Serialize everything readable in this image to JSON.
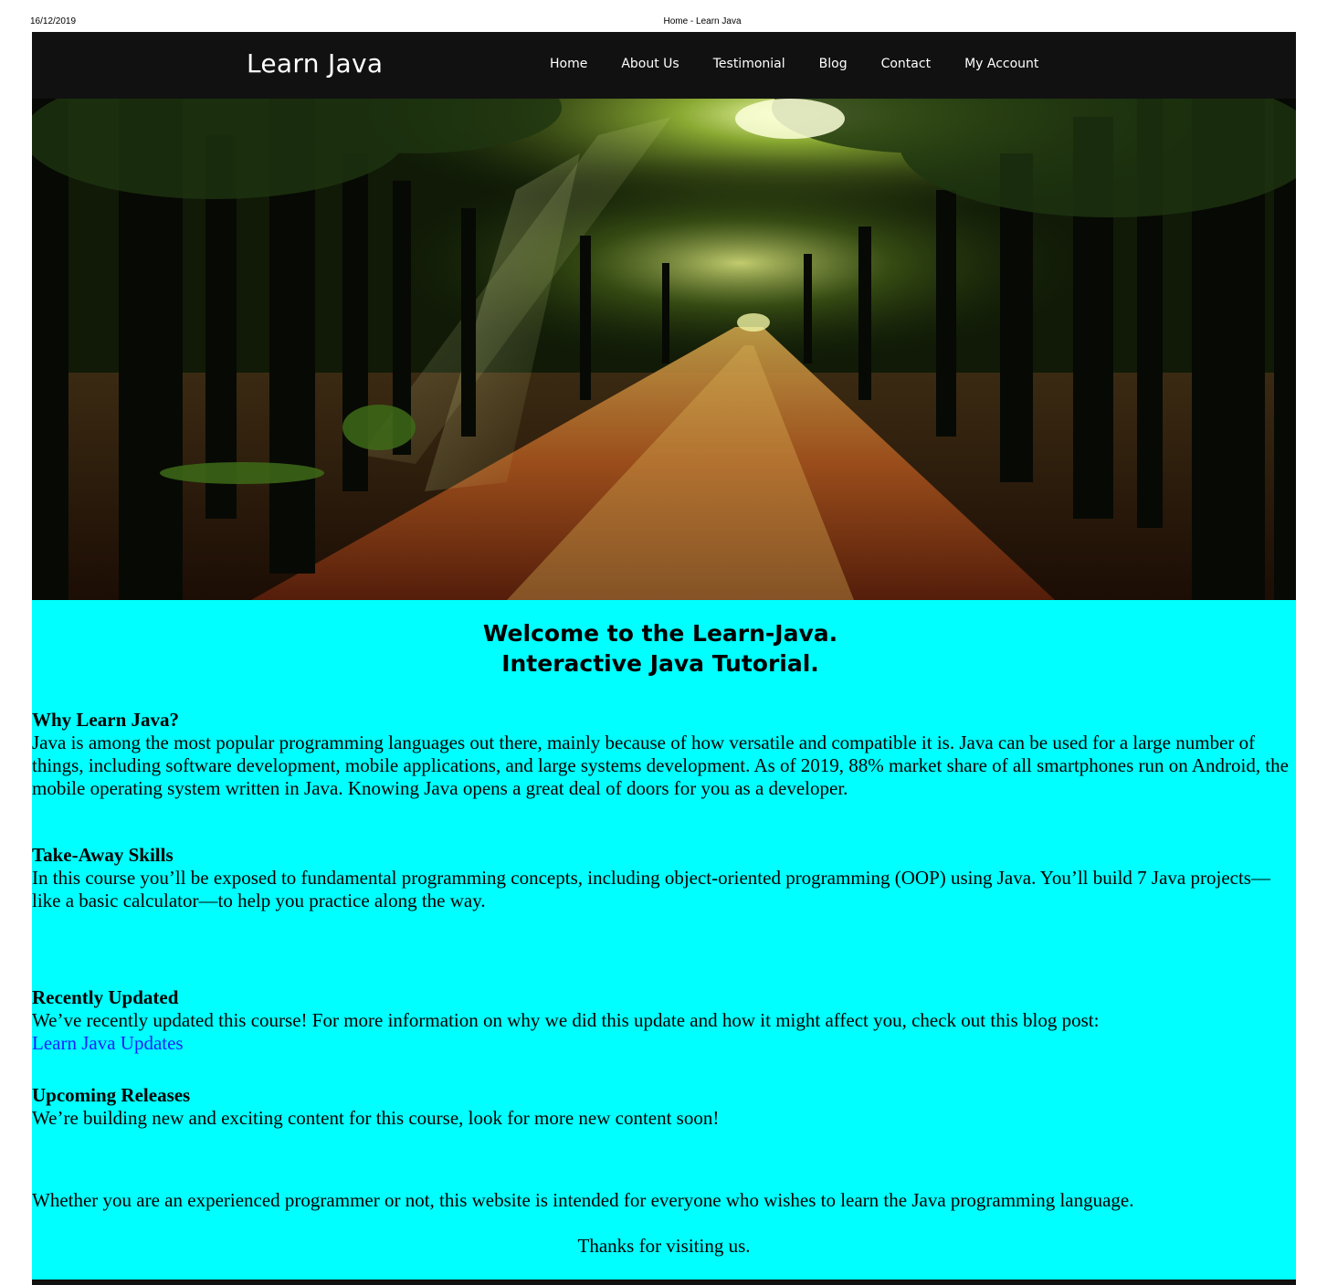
{
  "print": {
    "date": "16/12/2019",
    "title": "Home - Learn Java"
  },
  "navbar": {
    "brand": "Learn Java",
    "items": [
      {
        "label": "Home"
      },
      {
        "label": "About Us"
      },
      {
        "label": "Testimonial"
      },
      {
        "label": "Blog"
      },
      {
        "label": "Contact"
      },
      {
        "label": "My Account"
      }
    ]
  },
  "main": {
    "welcome_line1": "Welcome to the Learn-Java.",
    "welcome_line2": "Interactive Java Tutorial.",
    "why": {
      "heading": "Why Learn Java?",
      "body": "Java is among the most popular programming languages out there, mainly because of how versatile and compatible it is. Java can be used for a large number of things, including software development, mobile applications, and large systems development. As of 2019, 88% market share of all smartphones run on Android, the mobile operating system written in Java. Knowing Java opens a great deal of doors for you as a developer."
    },
    "skills": {
      "heading": "Take-Away Skills",
      "body": "In this course you’ll be exposed to fundamental programming concepts, including object-oriented programming (OOP) using Java. You’ll build 7 Java projects—like a basic calculator—to help you practice along the way."
    },
    "updated": {
      "heading": "Recently Updated",
      "body": "We’ve recently updated this course! For more information on why we did this update and how it might affect you, check out this blog post:",
      "link": "Learn Java Updates"
    },
    "upcoming": {
      "heading": "Upcoming Releases",
      "body": "We’re building new and exciting content for this course, look for more new content soon!"
    },
    "closing": "Whether you are an experienced programmer or not, this website is intended for everyone who wishes to learn the Java programming language.",
    "thanks": "Thanks for visiting us."
  },
  "colors": {
    "navbar_bg": "#111111",
    "content_bg": "#00ffff",
    "link": "#1f1fff"
  }
}
